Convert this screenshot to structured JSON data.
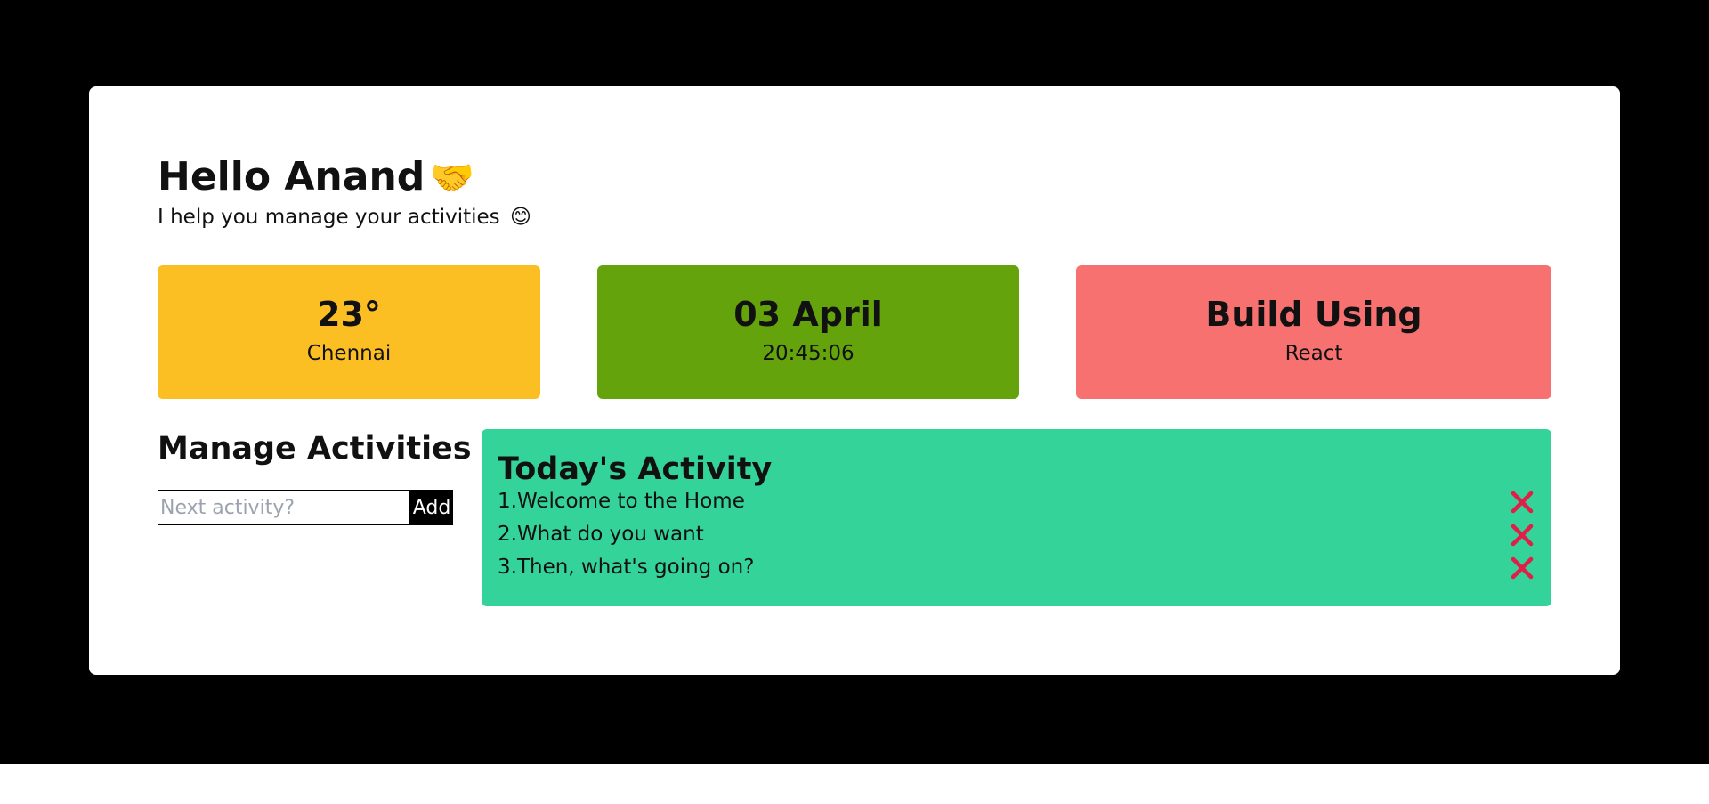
{
  "header": {
    "greeting": "Hello Anand",
    "greeting_emoji": "🤝",
    "subtitle": "I help you manage your activities",
    "subtitle_emoji": "😊"
  },
  "tiles": [
    {
      "title": "23°",
      "subtitle": "Chennai",
      "color": "#fbbf24"
    },
    {
      "title": "03 April",
      "subtitle": "20:45:06",
      "color": "#65a30d"
    },
    {
      "title": "Build Using",
      "subtitle": "React",
      "color": "#f87171"
    }
  ],
  "manage": {
    "title": "Manage Activities",
    "input_placeholder": "Next activity?",
    "input_value": "",
    "add_label": "Add"
  },
  "activity": {
    "title": "Today's Activity",
    "items": [
      {
        "label": "1.Welcome to the Home",
        "remove_icon": "close-icon"
      },
      {
        "label": "2.What do you want",
        "remove_icon": "close-icon"
      },
      {
        "label": "3.Then, what's going on?",
        "remove_icon": "close-icon"
      }
    ],
    "panel_color": "#34d399",
    "remove_color": "#e11d48"
  }
}
